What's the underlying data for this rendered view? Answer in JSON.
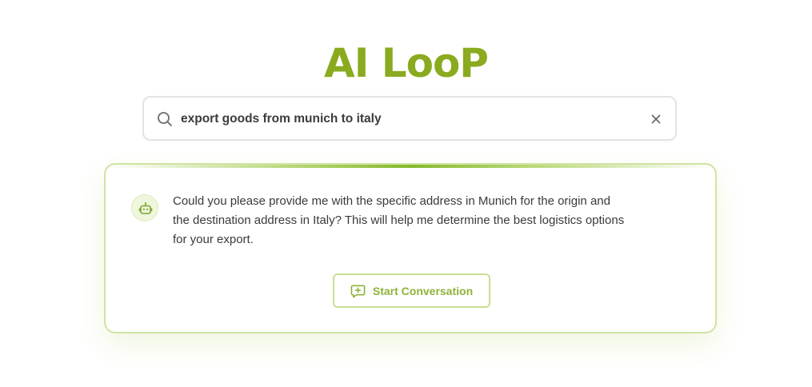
{
  "logo": {
    "text": "AI LooP"
  },
  "search": {
    "value": "export goods from munich to italy",
    "search_icon": "search-icon",
    "clear_icon": "close-icon"
  },
  "assistant": {
    "avatar_icon": "robot-icon",
    "message": "Could you please provide me with the specific address in Munich for the origin and the destination address in Italy? This will help me determine the best logistics options for your export."
  },
  "actions": {
    "start_conversation_label": "Start Conversation",
    "start_conversation_icon": "message-plus-icon"
  },
  "colors": {
    "brand": "#8aaa1f",
    "accent": "#8fb33a",
    "card_border": "#cfe3a3",
    "text": "#3a3a3a"
  }
}
